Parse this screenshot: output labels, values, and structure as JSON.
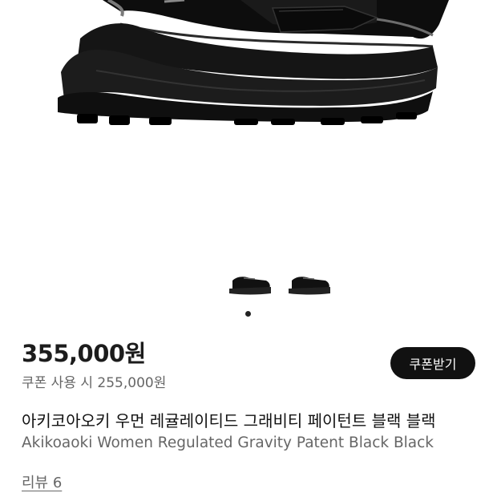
{
  "product": {
    "price": "355,000원",
    "coupon_price": "쿠폰 사용 시 255,000원",
    "coupon_button": "쿠폰받기",
    "title_ko": "아키코아오키 우먼 레귤레이티드 그래비티 페이턴트 블랙 블랙",
    "title_en": "Akikoaoki Women Regulated Gravity Patent Black Black",
    "reviews": "리뷰 6"
  },
  "gallery": {
    "image_count": 2,
    "active_index": 0,
    "dot_count": 1,
    "main_image": "black patent leather penny loafer with chunky sculpted sole",
    "thumb_icons": [
      "loafer-thumbnail",
      "loafer-thumbnail"
    ]
  },
  "colors": {
    "price": "#1c1c1c",
    "secondary_text": "#666666",
    "button_bg": "#111111",
    "button_text": "#ffffff"
  }
}
